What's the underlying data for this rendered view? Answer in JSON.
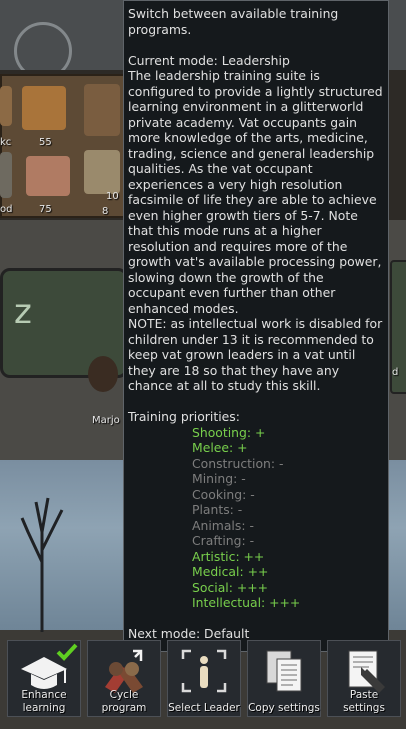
{
  "tooltip": {
    "header": "Switch between available training programs.",
    "current_mode": "Current mode: Leadership",
    "description": "The leadership training suite is configured to provide a lightly structured learning environment in a glitterworld private academy. Vat occupants gain more knowledge of the arts, medicine, trading, science and general leadership qualities. As the vat occupant experiences a very high resolution facsimile of life they are able to achieve even higher growth tiers of 5-7. Note that this mode runs at a higher resolution and requires more of the growth vat's available processing power, slowing down the growth of the occupant even further than other enhanced modes.",
    "note": "NOTE: as intellectual work is disabled for children under 13 it is recommended to keep vat grown leaders in a vat until they are 18 so that they have any chance at all to study this skill.",
    "priorities_title": "Training priorities:",
    "priorities": [
      {
        "text": "Shooting: +",
        "active": true
      },
      {
        "text": "Melee: +",
        "active": true
      },
      {
        "text": "Construction: -",
        "active": false
      },
      {
        "text": "Mining: -",
        "active": false
      },
      {
        "text": "Cooking: -",
        "active": false
      },
      {
        "text": "Plants: -",
        "active": false
      },
      {
        "text": "Animals: -",
        "active": false
      },
      {
        "text": "Crafting: -",
        "active": false
      },
      {
        "text": "Artistic: ++",
        "active": true
      },
      {
        "text": "Medical: ++",
        "active": true
      },
      {
        "text": "Social: +++",
        "active": true
      },
      {
        "text": "Intellectual: +++",
        "active": true
      }
    ],
    "next_mode": "Next mode: Default"
  },
  "background": {
    "stack_counts": [
      "55",
      "75",
      "10",
      "8"
    ],
    "partial_labels": [
      "kc",
      "od",
      "d"
    ],
    "pawn_name": "Marjo"
  },
  "toolbar": {
    "buttons": [
      {
        "label": "Enhance learning",
        "icon": "graduation-cap-icon",
        "checked": true
      },
      {
        "label": "Cycle program",
        "icon": "cycle-program-icon"
      },
      {
        "label": "Select Leader",
        "icon": "select-leader-icon"
      },
      {
        "label": "Copy settings",
        "icon": "copy-settings-icon"
      },
      {
        "label": "Paste settings",
        "icon": "paste-settings-icon"
      }
    ]
  },
  "colors": {
    "active_priority": "#78cf4c",
    "inactive_priority": "#7d7d7d",
    "checkmark": "#5fd021"
  }
}
